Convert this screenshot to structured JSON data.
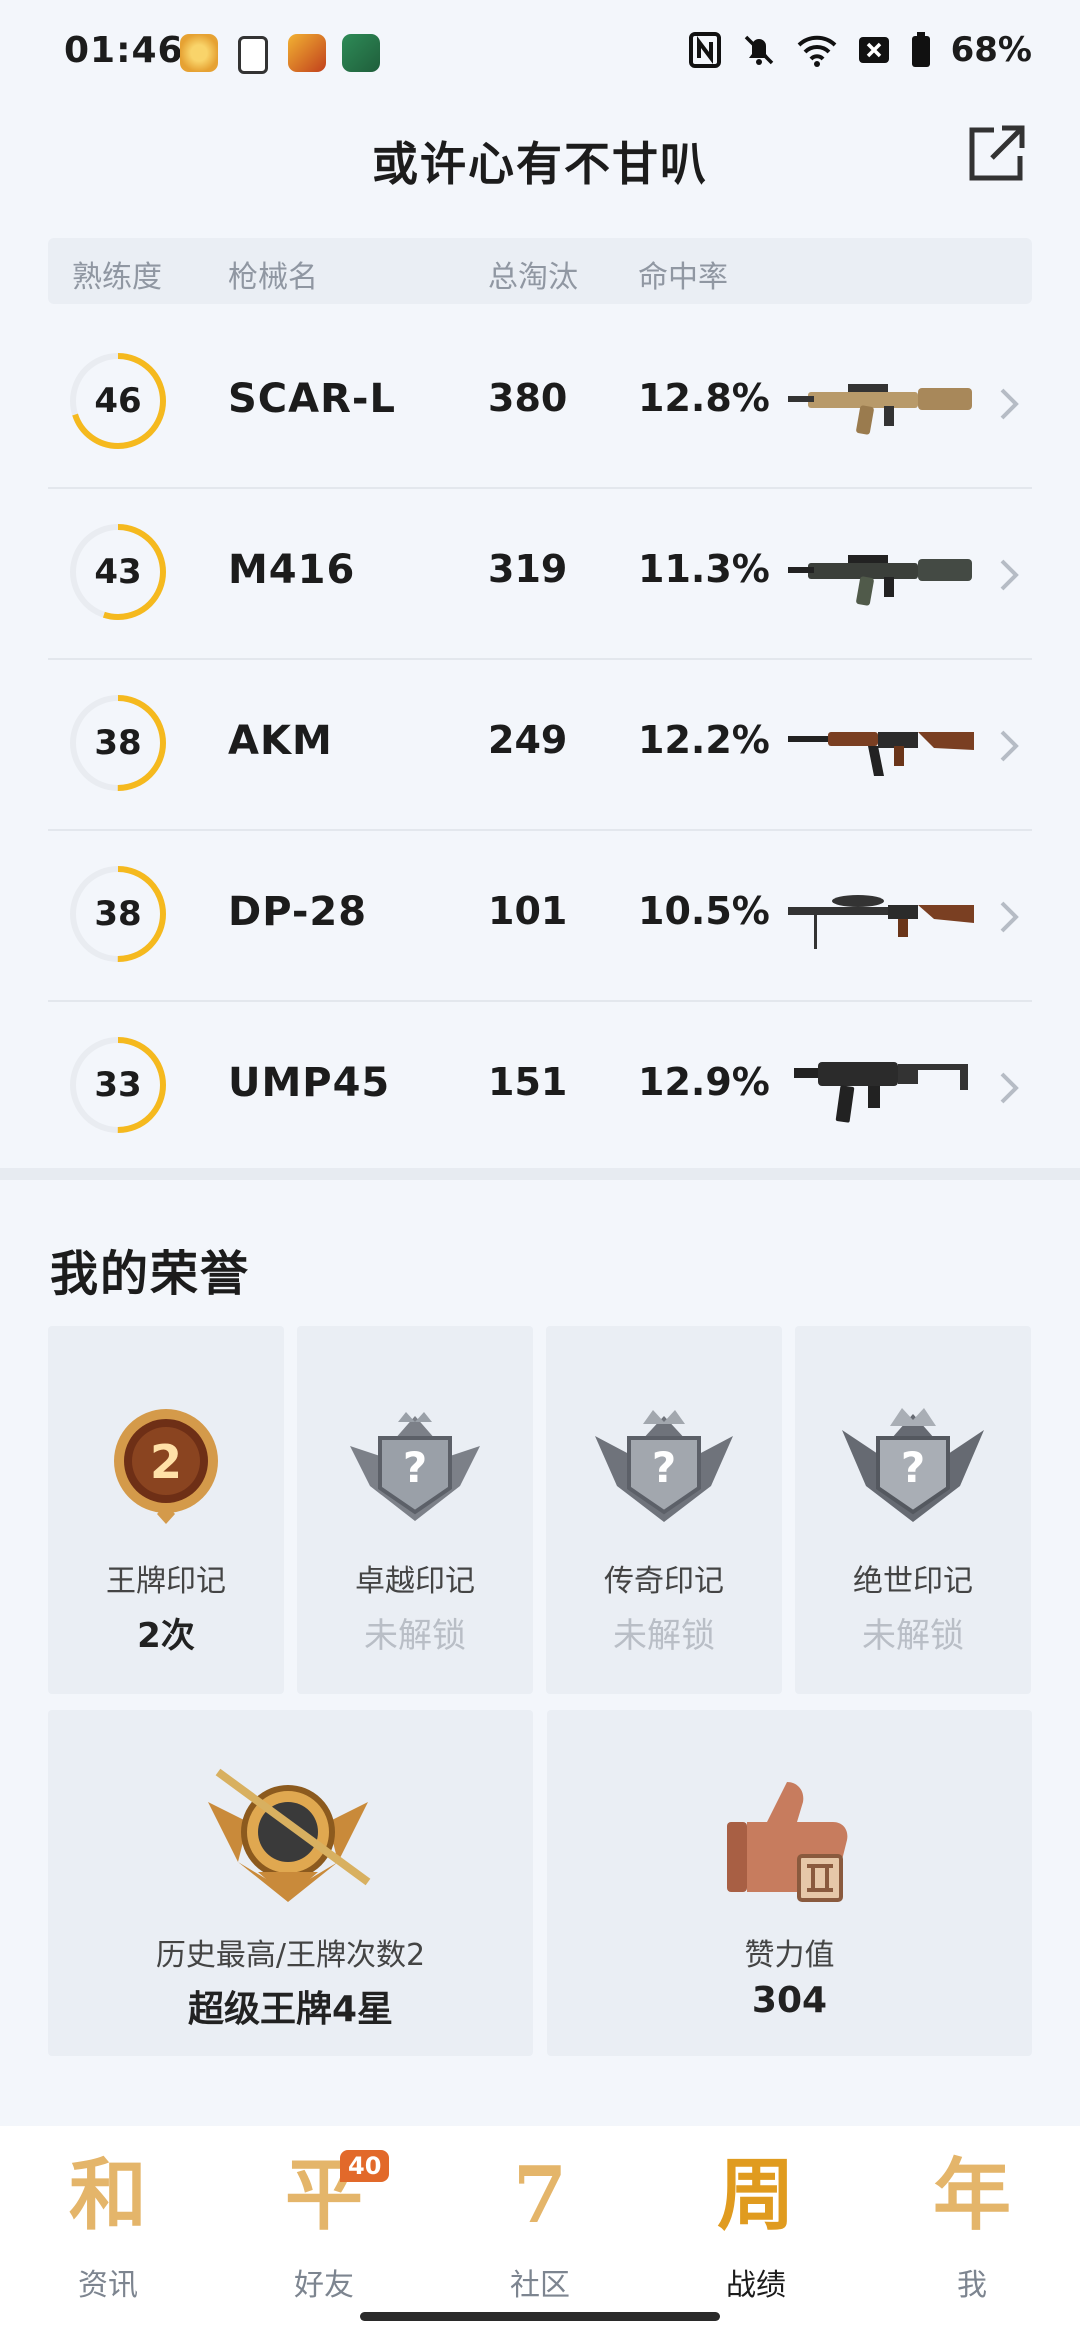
{
  "status": {
    "time": "01:46",
    "battery": "68%"
  },
  "header": {
    "title": "或许心有不甘叭"
  },
  "table": {
    "columns": [
      "熟练度",
      "枪械名",
      "总淘汰",
      "命中率"
    ],
    "rows": [
      {
        "proficiency": "46",
        "name": "SCAR-L",
        "kills": "380",
        "accuracy": "12.8%",
        "ring_fraction": 0.7
      },
      {
        "proficiency": "43",
        "name": "M416",
        "kills": "319",
        "accuracy": "11.3%",
        "ring_fraction": 0.55
      },
      {
        "proficiency": "38",
        "name": "AKM",
        "kills": "249",
        "accuracy": "12.2%",
        "ring_fraction": 0.5
      },
      {
        "proficiency": "38",
        "name": "DP-28",
        "kills": "101",
        "accuracy": "10.5%",
        "ring_fraction": 0.5
      },
      {
        "proficiency": "33",
        "name": "UMP45",
        "kills": "151",
        "accuracy": "12.9%",
        "ring_fraction": 0.5
      }
    ]
  },
  "honors": {
    "title": "我的荣誉",
    "marks": [
      {
        "label": "王牌印记",
        "value": "2次",
        "badge_number": "2",
        "locked": false
      },
      {
        "label": "卓越印记",
        "value": "未解锁",
        "locked": true
      },
      {
        "label": "传奇印记",
        "value": "未解锁",
        "locked": true
      },
      {
        "label": "绝世印记",
        "value": "未解锁",
        "locked": true
      }
    ],
    "stats": [
      {
        "label": "历史最高/王牌次数2",
        "value": "超级王牌4星"
      },
      {
        "label": "赞力值",
        "value": "304"
      }
    ]
  },
  "nav": {
    "items": [
      {
        "glyph": "和",
        "label": "资讯"
      },
      {
        "glyph": "平",
        "label": "好友",
        "badge": "40"
      },
      {
        "glyph": "7",
        "label": "社区"
      },
      {
        "glyph": "周",
        "label": "战绩"
      },
      {
        "glyph": "年",
        "label": "我"
      }
    ]
  },
  "colors": {
    "ring": "#f5b91e",
    "ring_track": "#e9ecf1",
    "accent": "#e09b1f"
  }
}
